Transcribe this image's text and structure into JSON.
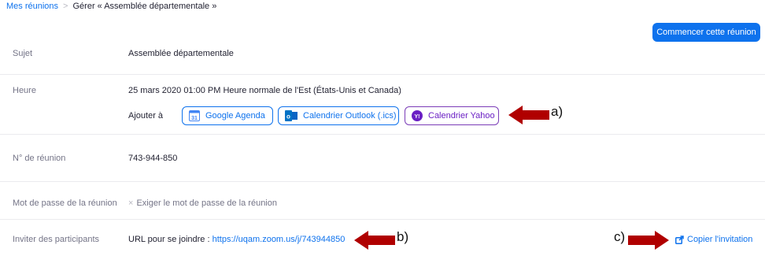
{
  "breadcrumb": {
    "root": "Mes réunions",
    "separator": ">",
    "current": "Gérer « Assemblée départementale »"
  },
  "start_button": "Commencer cette réunion",
  "subject": {
    "label": "Sujet",
    "value": "Assemblée départementale"
  },
  "time": {
    "label": "Heure",
    "value": "25 mars 2020 01:00 PM Heure normale de l'Est (États-Unis et Canada)",
    "add_to": "Ajouter à",
    "calendars": [
      {
        "label": "Google Agenda",
        "icon": "google-calendar-icon",
        "icon_text": "31"
      },
      {
        "label": "Calendrier Outlook (.ics)",
        "icon": "outlook-icon",
        "icon_text": "o"
      },
      {
        "label": "Calendrier Yahoo",
        "icon": "yahoo-icon",
        "icon_text": "Y!"
      }
    ]
  },
  "meeting_id": {
    "label": "N° de réunion",
    "value": "743-944-850"
  },
  "password": {
    "label": "Mot de passe de la réunion",
    "mark": "×",
    "value": "Exiger le mot de passe de la réunion"
  },
  "invite": {
    "label": "Inviter des participants",
    "url_prefix": "URL pour se joindre :",
    "url": "https://uqam.zoom.us/j/743944850",
    "copy_label": "Copier l'invitation"
  },
  "annotations": {
    "a": "a)",
    "b": "b)",
    "c": "c)"
  },
  "colors": {
    "accent": "#0e72ed",
    "yahoo": "#6a1fc4",
    "annotation_arrow": "#b00000"
  }
}
